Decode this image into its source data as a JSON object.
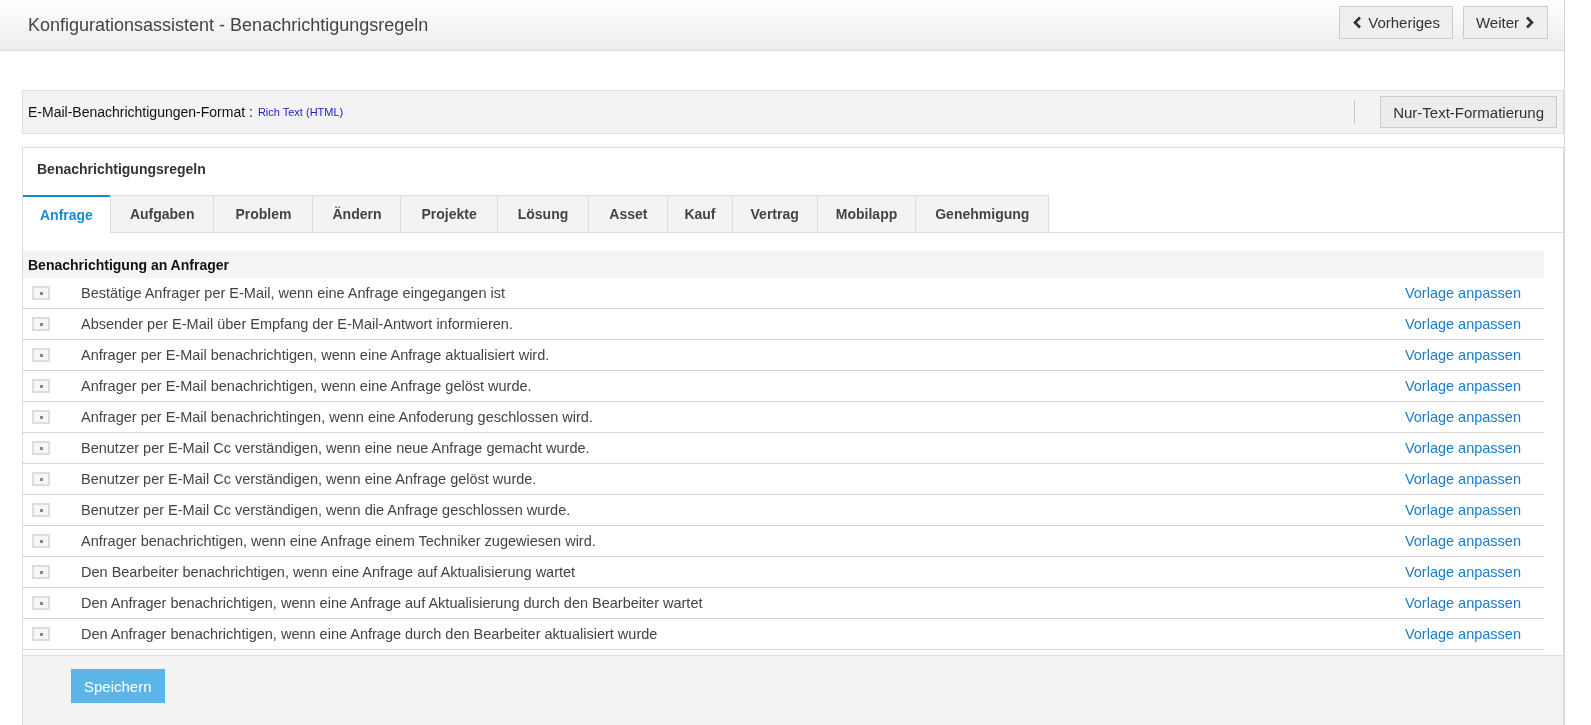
{
  "header": {
    "title": "Konfigurationsassistent - Benachrichtigungsregeln",
    "buttons": [
      {
        "label": "Vorheriges",
        "kind": "prev"
      },
      {
        "label": "Weiter",
        "kind": "next"
      }
    ]
  },
  "format_bar": {
    "label": "E-Mail-Benachrichtigungen-Format :",
    "value": "Rich Text (HTML)",
    "button": "Nur-Text-Formatierung"
  },
  "panel": {
    "title": "Benachrichtigungsregeln",
    "tabs": [
      {
        "label": "Anfrage",
        "selected": true
      },
      {
        "label": "Aufgaben",
        "selected": false
      },
      {
        "label": "Problem",
        "selected": false
      },
      {
        "label": "Ändern",
        "selected": false
      },
      {
        "label": "Projekte",
        "selected": false
      },
      {
        "label": "Lösung",
        "selected": false
      },
      {
        "label": "Asset",
        "selected": false
      },
      {
        "label": "Kauf",
        "selected": false
      },
      {
        "label": "Vertrag",
        "selected": false
      },
      {
        "label": "Mobilapp",
        "selected": false
      },
      {
        "label": "Genehmigung",
        "selected": false
      }
    ],
    "section": "Benachrichtigung an Anfrager",
    "rules": [
      {
        "text": "Bestätige Anfrager per E-Mail, wenn eine Anfrage eingegangen ist",
        "checked": false,
        "link": "Vorlage anpassen"
      },
      {
        "text": "Absender per E-Mail über Empfang der E-Mail-Antwort informieren.",
        "checked": false,
        "link": "Vorlage anpassen"
      },
      {
        "text": "Anfrager per E-Mail benachrichtigen, wenn eine Anfrage aktualisiert wird.",
        "checked": false,
        "link": "Vorlage anpassen"
      },
      {
        "text": "Anfrager per E-Mail benachrichtigen, wenn eine Anfrage gelöst wurde.",
        "checked": false,
        "link": "Vorlage anpassen"
      },
      {
        "text": "Anfrager per E-Mail benachrichtingen, wenn eine Anfoderung geschlossen wird.",
        "checked": false,
        "link": "Vorlage anpassen"
      },
      {
        "text": "Benutzer per E-Mail Cc verständigen, wenn eine neue Anfrage gemacht wurde.",
        "checked": false,
        "link": "Vorlage anpassen"
      },
      {
        "text": "Benutzer per E-Mail Cc verständigen, wenn eine Anfrage gelöst wurde.",
        "checked": false,
        "link": "Vorlage anpassen"
      },
      {
        "text": "Benutzer per E-Mail Cc verständigen, wenn die Anfrage geschlossen wurde.",
        "checked": false,
        "link": "Vorlage anpassen"
      },
      {
        "text": "Anfrager benachrichtigen, wenn eine Anfrage einem Techniker zugewiesen wird.",
        "checked": false,
        "link": "Vorlage anpassen"
      },
      {
        "text": "Den Bearbeiter benachrichtigen, wenn eine Anfrage auf Aktualisierung wartet",
        "checked": false,
        "link": "Vorlage anpassen"
      },
      {
        "text": "Den Anfrager benachrichtigen, wenn eine Anfrage auf Aktualisierung durch den Bearbeiter wartet",
        "checked": false,
        "link": "Vorlage anpassen"
      },
      {
        "text": "Den Anfrager benachrichtigen, wenn eine Anfrage durch den Bearbeiter aktualisiert wurde",
        "checked": false,
        "link": "Vorlage anpassen"
      }
    ],
    "save_button": "Speichern"
  }
}
